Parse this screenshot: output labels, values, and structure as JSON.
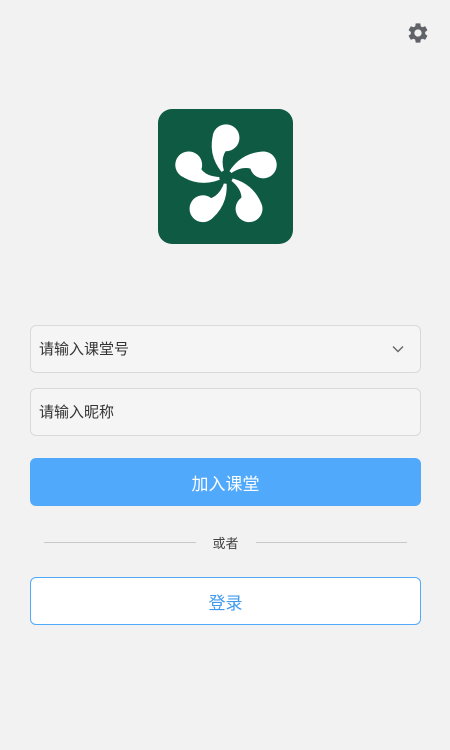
{
  "header": {
    "settings_icon": "gear-icon"
  },
  "logo": {
    "icon": "pinwheel-logo",
    "background": "#0f5a42"
  },
  "form": {
    "class_code_placeholder": "请输入课堂号",
    "class_code_value": "",
    "class_code_dropdown_icon": "chevron-down-icon",
    "nickname_placeholder": "请输入昵称",
    "nickname_value": "",
    "join_label": "加入课堂",
    "divider_text": "或者",
    "login_label": "登录"
  },
  "colors": {
    "primary": "#51a9fb",
    "background": "#f2f2f2",
    "logo_green": "#0f5a42"
  }
}
